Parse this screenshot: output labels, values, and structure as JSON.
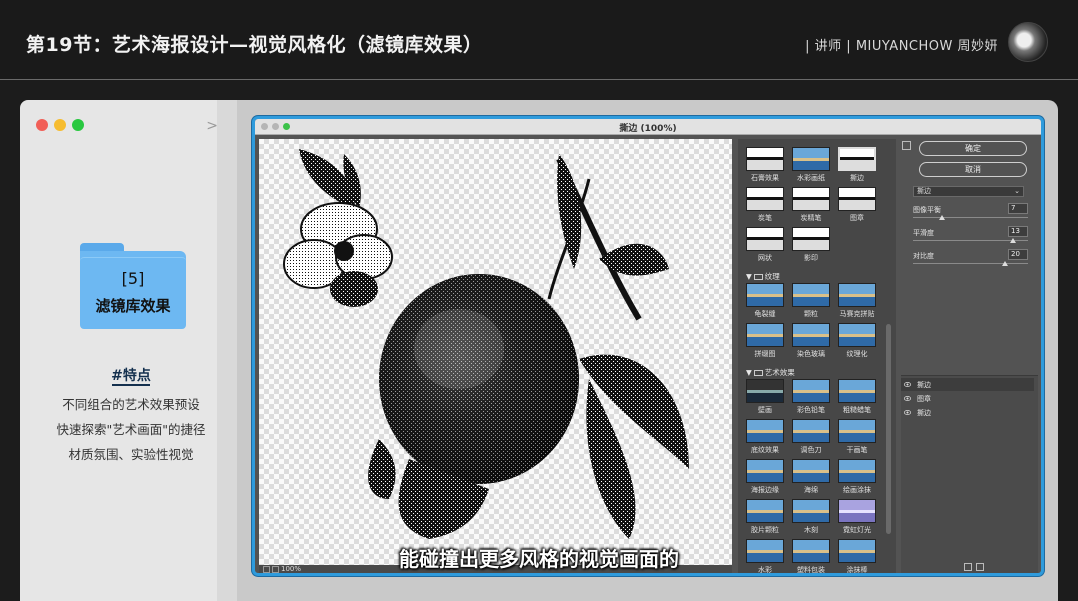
{
  "header": {
    "title": "第19节：艺术海报设计—视觉风格化（滤镜库效果）",
    "right_text": "| 讲师 | MIUYANCHOW 周妙妍"
  },
  "card": {
    "arrow": ">",
    "folder_number": "[5]",
    "folder_label": "滤镜库效果",
    "feature_title": "#特点",
    "features": [
      "不同组合的艺术效果预设",
      "快速探索\"艺术画面\"的捷径",
      "材质氛围、实验性视觉"
    ]
  },
  "dialog": {
    "title": "撕边 (100%)",
    "zoom": "100%"
  },
  "gallery": {
    "top_rows": [
      [
        {
          "label": "石膏效果",
          "style": "mono"
        },
        {
          "label": "水彩画纸",
          "style": "blue"
        },
        {
          "label": "撕边",
          "style": "mono",
          "selected": true
        }
      ],
      [
        {
          "label": "炭笔",
          "style": "mono"
        },
        {
          "label": "炭精笔",
          "style": "mono"
        },
        {
          "label": "图章",
          "style": "mono"
        }
      ],
      [
        {
          "label": "网状",
          "style": "mono"
        },
        {
          "label": "影印",
          "style": "mono"
        }
      ]
    ],
    "categories": [
      {
        "name": "纹理",
        "rows": [
          [
            {
              "label": "龟裂缝",
              "style": "blue"
            },
            {
              "label": "颗粒",
              "style": "blue"
            },
            {
              "label": "马赛克拼贴",
              "style": "blue"
            }
          ],
          [
            {
              "label": "拼缀图",
              "style": "blue"
            },
            {
              "label": "染色玻璃",
              "style": "blue"
            },
            {
              "label": "纹理化",
              "style": "blue"
            }
          ]
        ]
      },
      {
        "name": "艺术效果",
        "rows": [
          [
            {
              "label": "壁画",
              "style": "dark"
            },
            {
              "label": "彩色铅笔",
              "style": "blue"
            },
            {
              "label": "粗糙蜡笔",
              "style": "blue"
            }
          ],
          [
            {
              "label": "底纹效果",
              "style": "blue"
            },
            {
              "label": "调色刀",
              "style": "blue"
            },
            {
              "label": "干画笔",
              "style": "blue"
            }
          ],
          [
            {
              "label": "海报边缘",
              "style": "blue"
            },
            {
              "label": "海绵",
              "style": "blue"
            },
            {
              "label": "绘画涂抹",
              "style": "blue"
            }
          ],
          [
            {
              "label": "胶片颗粒",
              "style": "blue"
            },
            {
              "label": "木刻",
              "style": "blue"
            },
            {
              "label": "霓虹灯光",
              "style": "violet"
            }
          ],
          [
            {
              "label": "水彩",
              "style": "blue"
            },
            {
              "label": "塑料包装",
              "style": "blue"
            },
            {
              "label": "涂抹棒",
              "style": "blue"
            }
          ]
        ]
      }
    ]
  },
  "panel": {
    "ok_label": "确定",
    "cancel_label": "取消",
    "filter_select": "撕边",
    "params": [
      {
        "label": "图像平衡",
        "value": "7",
        "fraction": 0.25
      },
      {
        "label": "平滑度",
        "value": "13",
        "fraction": 0.87
      },
      {
        "label": "对比度",
        "value": "20",
        "fraction": 0.8
      }
    ],
    "layers": [
      "撕边",
      "图章",
      "撕边"
    ]
  },
  "subtitle": "能碰撞出更多风格的视觉画面的",
  "colors": {
    "dialog_border": "#2f9bdc",
    "folder": "#6db8f2",
    "feature_title": "#14304e"
  }
}
